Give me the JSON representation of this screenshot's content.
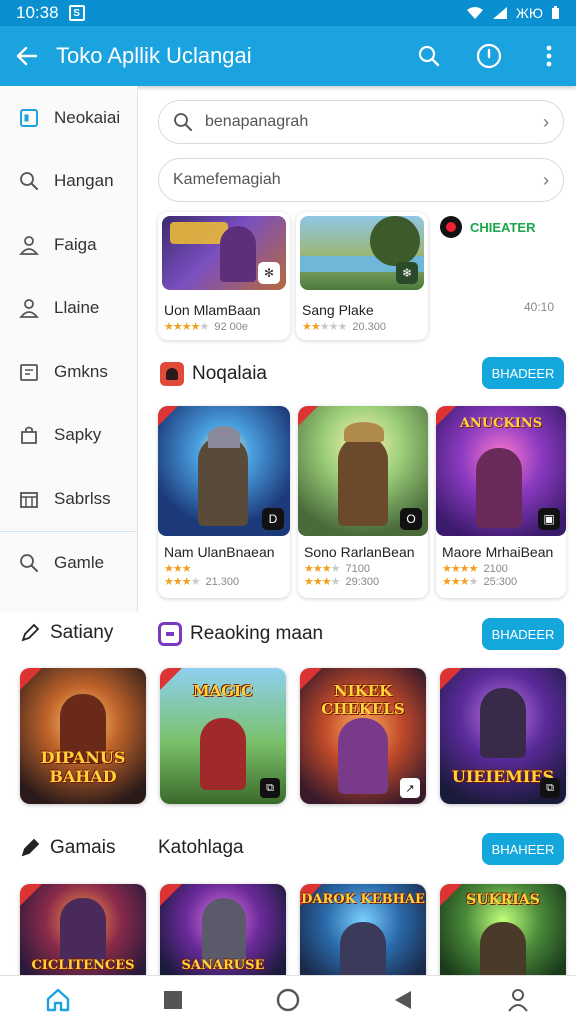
{
  "status": {
    "time": "10:38",
    "right": "ЖЮ"
  },
  "appbar": {
    "title": "Toko Apllik Uclangai"
  },
  "sidebar": {
    "items": [
      {
        "label": "Neokaiai",
        "icon": "square-icon"
      },
      {
        "label": "Hangan",
        "icon": "search-icon"
      },
      {
        "label": "Faiga",
        "icon": "person-icon"
      },
      {
        "label": "Llaine",
        "icon": "person-icon"
      },
      {
        "label": "Gmkns",
        "icon": "calendar-icon"
      },
      {
        "label": "Sapky",
        "icon": "bag-icon"
      },
      {
        "label": "Sabrlss",
        "icon": "grid-icon"
      },
      {
        "label": "Gamle",
        "icon": "search-icon"
      }
    ]
  },
  "search": {
    "primary_placeholder": "benapanagrah",
    "secondary_placeholder": "Kamefemagiah"
  },
  "featured": {
    "cards": [
      {
        "name": "Uon MlamBaan",
        "rating": 4,
        "meta": "92 00e"
      },
      {
        "name": "Sang Plake",
        "rating": 2,
        "meta": "20.300"
      }
    ],
    "side_app": {
      "name": "CHIEATER",
      "meta": "40:10"
    }
  },
  "section1": {
    "title": "Noqalaia",
    "button": "BHADEER",
    "cards": [
      {
        "name": "Nam UlanBnaean",
        "rating": 3,
        "rating2": 3,
        "meta1": "",
        "meta2": "21.300"
      },
      {
        "name": "Sono RarlanBean",
        "rating": 3,
        "rating2": 3,
        "meta1": "7100",
        "meta2": "29:300"
      },
      {
        "name": "Maore MrhaiBean",
        "rating": 4,
        "rating2": 3,
        "meta1": "2100",
        "meta2": "25:300"
      }
    ]
  },
  "section2": {
    "left_title": "Satiany",
    "title": "Reaoking maan",
    "button": "BHADEER",
    "tiles": [
      {
        "text": "DIPANUS BAHAD",
        "top": ""
      },
      {
        "text": "",
        "top": "MAGIC"
      },
      {
        "text": "",
        "top": "NIKEK CHEKELS"
      },
      {
        "text": "UIEIEMIES",
        "top": ""
      }
    ]
  },
  "section3": {
    "left_title": "Gamais",
    "title": "Katohlaga",
    "button": "BHAHEER",
    "tiles": [
      {
        "text": "CICLITENCES",
        "top": ""
      },
      {
        "text": "SANARUSE",
        "top": ""
      },
      {
        "text": "",
        "top": "DAROK KEBHAE"
      },
      {
        "text": "",
        "top": "SUKRIAS"
      }
    ]
  },
  "colors": {
    "primary": "#1ba3e0",
    "status": "#0a8fd0",
    "button": "#14a7dc",
    "star": "#f2a020"
  }
}
